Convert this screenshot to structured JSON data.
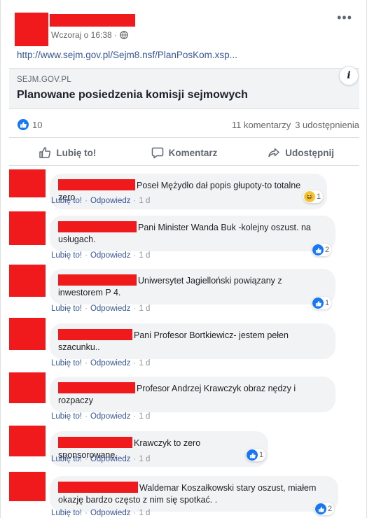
{
  "post": {
    "timestamp": "Wczoraj o 16:38 ·",
    "link": "http://www.sejm.gov.pl/Sejm8.nsf/PlanPosKom.xsp...",
    "preview_domain": "SEJM.GOV.PL",
    "preview_title": "Planowane posiedzenia komisji sejmowych",
    "likes": "10",
    "comments_count": "11 komentarzy",
    "shares_count": "3 udostępnienia"
  },
  "actions": {
    "like": "Lubię to!",
    "comment": "Komentarz",
    "share": "Udostępnij"
  },
  "comment_labels": {
    "like": "Lubię to!",
    "reply": "Odpowiedz",
    "sep": "·"
  },
  "comments": [
    {
      "text": "Poseł Mężydło dał popis głupoty-to totalne zero",
      "time": "1 d",
      "reaction_count": "1",
      "reaction_icon": "haha-icon"
    },
    {
      "text": "Pani Minister Wanda Buk -kolejny oszust. na usługach.",
      "time": "1 d",
      "reaction_count": "2",
      "reaction_icon": "like-icon"
    },
    {
      "text": "Uniwersytet Jagielloński powiązany z inwestorem P 4.",
      "time": "1 d",
      "reaction_count": "1",
      "reaction_icon": "like-icon"
    },
    {
      "text": "Pani Profesor Bortkiewicz- jestem pełen szacunku..",
      "time": "1 d",
      "reaction_count": "",
      "reaction_icon": ""
    },
    {
      "text": "Profesor Andrzej Krawczyk obraz nędzy i rozpaczy",
      "time": "1 d",
      "reaction_count": "",
      "reaction_icon": ""
    },
    {
      "text": "Krawczyk to zero sponsorowane.",
      "time": "1 d",
      "reaction_count": "1",
      "reaction_icon": "like-icon"
    },
    {
      "text": "Waldemar Koszałkowski stary oszust, miałem okazję bardzo często z nim się spotkać. .",
      "time": "1 d",
      "reaction_count": "2",
      "reaction_icon": "like-icon"
    }
  ],
  "colors": {
    "redaction": "#f0191c",
    "facebook_blue": "#1877f2",
    "link": "#385898"
  }
}
